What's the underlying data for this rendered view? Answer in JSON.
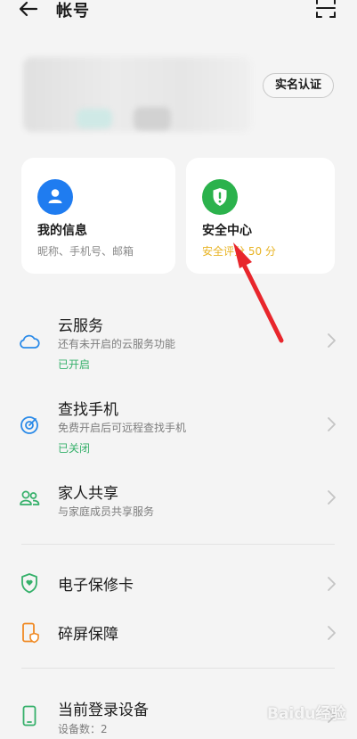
{
  "header": {
    "title": "帐号"
  },
  "profile": {
    "realname_label": "实名认证"
  },
  "cards": {
    "info": {
      "title": "我的信息",
      "subtitle": "昵称、手机号、邮箱"
    },
    "security": {
      "title": "安全中心",
      "score": "安全评分 50 分",
      "score_color": "#e8b323"
    }
  },
  "list": {
    "cloud": {
      "title": "云服务",
      "subtitle": "还有未开启的云服务功能",
      "status": "已开启",
      "icon": "cloud-icon"
    },
    "find": {
      "title": "查找手机",
      "subtitle": "免费开启后可远程查找手机",
      "status": "已关闭",
      "icon": "target-icon"
    },
    "family": {
      "title": "家人共享",
      "subtitle": "与家庭成员共享服务",
      "icon": "people-icon"
    },
    "warranty": {
      "title": "电子保修卡",
      "icon": "shield-heart-icon"
    },
    "screen": {
      "title": "碎屏保障",
      "icon": "phone-protect-icon"
    },
    "devices": {
      "title": "当前登录设备",
      "subtitle": "设备数：2",
      "icon": "device-icon"
    }
  },
  "watermark": "Baidu经验",
  "colors": {
    "accent_blue": "#1f7cf0",
    "accent_green": "#2bb24c",
    "status_green": "#35b06a",
    "annotation_red": "#e8262c"
  }
}
